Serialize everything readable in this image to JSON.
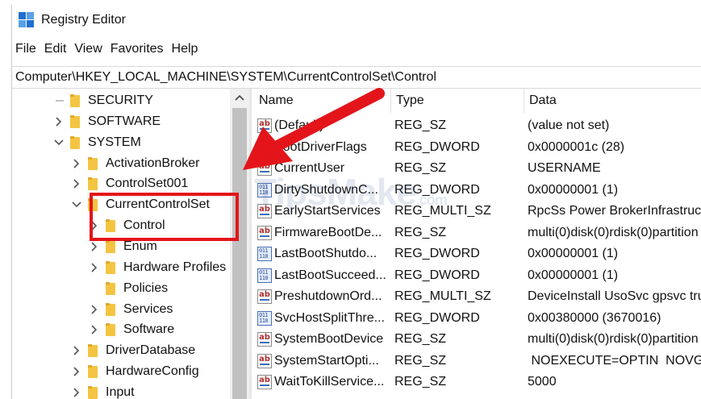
{
  "window": {
    "title": "Registry Editor"
  },
  "menu": [
    "File",
    "Edit",
    "View",
    "Favorites",
    "Help"
  ],
  "address": "Computer\\HKEY_LOCAL_MACHINE\\SYSTEM\\CurrentControlSet\\Control",
  "tree": [
    {
      "label": "SECURITY",
      "level": 0,
      "chevron": "line"
    },
    {
      "label": "SOFTWARE",
      "level": 0,
      "chevron": "right"
    },
    {
      "label": "SYSTEM",
      "level": 0,
      "chevron": "down"
    },
    {
      "label": "ActivationBroker",
      "level": 1,
      "chevron": "right"
    },
    {
      "label": "ControlSet001",
      "level": 1,
      "chevron": "right"
    },
    {
      "label": "CurrentControlSet",
      "level": 1,
      "chevron": "down"
    },
    {
      "label": "Control",
      "level": 2,
      "chevron": "right",
      "selected": true
    },
    {
      "label": "Enum",
      "level": 2,
      "chevron": "right"
    },
    {
      "label": "Hardware Profiles",
      "level": 2,
      "chevron": "right"
    },
    {
      "label": "Policies",
      "level": 2,
      "chevron": "none"
    },
    {
      "label": "Services",
      "level": 2,
      "chevron": "right"
    },
    {
      "label": "Software",
      "level": 2,
      "chevron": "right"
    },
    {
      "label": "DriverDatabase",
      "level": 1,
      "chevron": "right"
    },
    {
      "label": "HardwareConfig",
      "level": 1,
      "chevron": "right"
    },
    {
      "label": "Input",
      "level": 1,
      "chevron": "right"
    }
  ],
  "columns": {
    "name": "Name",
    "type": "Type",
    "data": "Data"
  },
  "values": [
    {
      "name": "(Default)",
      "type": "REG_SZ",
      "data": "(value not set)",
      "icon": "string-value-icon"
    },
    {
      "name": "BootDriverFlags",
      "type": "REG_DWORD",
      "data": "0x0000001c (28)",
      "icon": "binary-value-icon"
    },
    {
      "name": "CurrentUser",
      "type": "REG_SZ",
      "data": "USERNAME",
      "icon": "string-value-icon"
    },
    {
      "name": "DirtyShutdownC...",
      "type": "REG_DWORD",
      "data": "0x00000001 (1)",
      "icon": "binary-value-icon"
    },
    {
      "name": "EarlyStartServices",
      "type": "REG_MULTI_SZ",
      "data": "RpcSs Power BrokerInfrastruct",
      "icon": "string-value-icon"
    },
    {
      "name": "FirmwareBootDe...",
      "type": "REG_SZ",
      "data": "multi(0)disk(0)rdisk(0)partition",
      "icon": "string-value-icon"
    },
    {
      "name": "LastBootShutdo...",
      "type": "REG_DWORD",
      "data": "0x00000001 (1)",
      "icon": "binary-value-icon"
    },
    {
      "name": "LastBootSucceed...",
      "type": "REG_DWORD",
      "data": "0x00000001 (1)",
      "icon": "binary-value-icon"
    },
    {
      "name": "PreshutdownOrd...",
      "type": "REG_MULTI_SZ",
      "data": "DeviceInstall UsoSvc gpsvc tru",
      "icon": "string-value-icon"
    },
    {
      "name": "SvcHostSplitThre...",
      "type": "REG_DWORD",
      "data": "0x00380000 (3670016)",
      "icon": "binary-value-icon"
    },
    {
      "name": "SystemBootDevice",
      "type": "REG_SZ",
      "data": "multi(0)disk(0)rdisk(0)partition",
      "icon": "string-value-icon"
    },
    {
      "name": "SystemStartOpti...",
      "type": "REG_SZ",
      "data": " NOEXECUTE=OPTIN  NOVGA",
      "icon": "string-value-icon"
    },
    {
      "name": "WaitToKillService...",
      "type": "REG_SZ",
      "data": "5000",
      "icon": "string-value-icon"
    }
  ],
  "watermark": {
    "text": "TipsMake",
    "suffix": ".com"
  },
  "colors": {
    "highlight": "#e3151a",
    "arrow": "#e3151a",
    "folder": "#f4c542"
  }
}
